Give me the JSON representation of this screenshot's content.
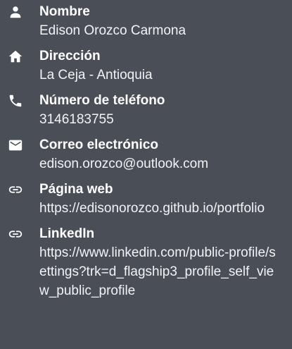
{
  "contact": {
    "name": {
      "icon": "person-icon",
      "label": "Nombre",
      "value": "Edison Orozco Carmona"
    },
    "address": {
      "icon": "home-icon",
      "label": "Dirección",
      "value": "La Ceja - Antioquia"
    },
    "phone": {
      "icon": "phone-icon",
      "label": "Número de teléfono",
      "value": "3146183755"
    },
    "email": {
      "icon": "mail-icon",
      "label": "Correo electrónico",
      "value": "edison.orozco@outlook.com"
    },
    "website": {
      "icon": "link-icon",
      "label": "Página web",
      "value": "https://edisonorozco.github.io/portfolio"
    },
    "linkedin": {
      "icon": "link-icon",
      "label": "LinkedIn",
      "value": "https://www.linkedin.com/public-profile/settings?trk=d_flagship3_profile_self_view_public_profile"
    }
  },
  "colors": {
    "background": "#4a4f57",
    "text": "#ffffff"
  }
}
